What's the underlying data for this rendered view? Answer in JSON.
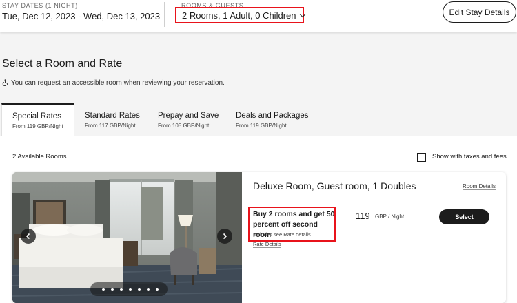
{
  "header": {
    "stay_label": "STAY DATES (1 NIGHT)",
    "stay_dates": "Tue, Dec 12, 2023 - Wed, Dec 13, 2023",
    "rooms_label": "ROOMS & GUESTS",
    "rooms_value": "2 Rooms, 1 Adult, 0 Children",
    "edit_button": "Edit Stay Details"
  },
  "page": {
    "title": "Select a Room and Rate",
    "accessible_note": "You can request an accessible room when reviewing your reservation."
  },
  "tabs": [
    {
      "label": "Special Rates",
      "sub": "From 119 GBP/Night"
    },
    {
      "label": "Standard Rates",
      "sub": "From 117 GBP/Night"
    },
    {
      "label": "Prepay and Save",
      "sub": "From 105 GBP/Night"
    },
    {
      "label": "Deals and Packages",
      "sub": "From 119 GBP/Night"
    }
  ],
  "results": {
    "available": "2 Available Rooms",
    "taxes_label": "Show with taxes and fees"
  },
  "room": {
    "title": "Deluxe Room, Guest room, 1 Doubles",
    "details_link": "Room Details",
    "rate_name": "Buy 2 rooms and get 50 percent off second room",
    "rate_sub": "Includes see Rate details",
    "rate_details_link": "Rate Details",
    "price": "119",
    "price_unit": "GBP / Night",
    "select_button": "Select"
  },
  "icons": {
    "wheelchair": "wheelchair-icon",
    "dropdown": "chevron-down-icon",
    "prev": "chevron-left-icon",
    "next": "chevron-right-icon"
  },
  "colors": {
    "highlight": "#e8131b",
    "primary": "#1c1c1c"
  }
}
